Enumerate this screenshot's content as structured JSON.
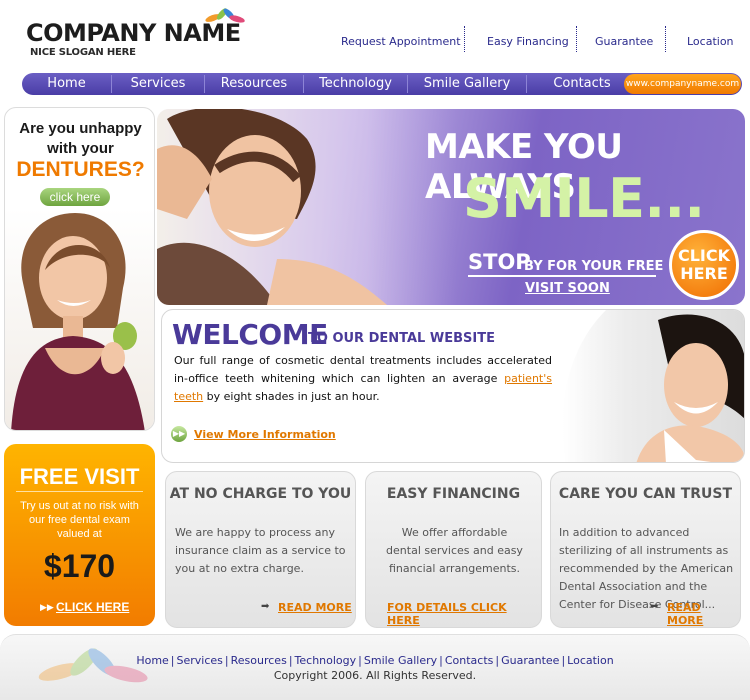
{
  "header": {
    "company_name": "COMPANY NAME",
    "slogan": "NICE SLOGAN HERE",
    "top_links": [
      "Request Appointment",
      "Easy Financing",
      "Guarantee",
      "Location"
    ]
  },
  "nav": {
    "items": [
      "Home",
      "Services",
      "Resources",
      "Technology",
      "Smile Gallery",
      "Contacts"
    ],
    "url": "www.companyname.com"
  },
  "promo": {
    "line1": "Are you unhappy",
    "line2": "with your",
    "line3": "DENTURES?",
    "button": "click here"
  },
  "free_visit": {
    "title": "FREE VISIT",
    "text": "Try us out at no risk with our free dental exam valued at",
    "price": "$170",
    "cta": "CLICK HERE"
  },
  "hero": {
    "line1": "MAKE YOU ALWAYS",
    "line2": "SMILE...",
    "stop": "STOP",
    "stop_rest": "BY FOR YOUR FREE",
    "visit": "VISIT SOON",
    "click1": "CLICK",
    "click2": "HERE"
  },
  "welcome": {
    "title": "WELCOME",
    "subtitle": "TO OUR DENTAL WEBSITE",
    "body_before": "Our full range of cosmetic dental treatments includes accelerated in-office teeth whitening which can lighten an average ",
    "body_link": "patient's teeth",
    "body_after": " by eight shades in just an hour.",
    "more": "View More Information"
  },
  "cards": [
    {
      "title": "AT NO CHARGE TO YOU",
      "body": "We are happy to process any insurance claim as a service to you at no extra charge.",
      "link": "READ MORE"
    },
    {
      "title": "EASY FINANCING",
      "body": "We offer affordable dental services and easy financial arrangements.",
      "link": "FOR DETAILS CLICK HERE"
    },
    {
      "title": "CARE YOU CAN TRUST",
      "body": "In addition to advanced sterilizing of all instruments as recommended by the American Dental Association and the Center for Disease Control...",
      "link": "READ MORE"
    }
  ],
  "footer": {
    "links": [
      "Home",
      "Services",
      "Resources",
      "Technology",
      "Smile Gallery",
      "Contacts",
      "Guarantee",
      "Location"
    ],
    "copyright": "Copyright 2006. All Rights Reserved."
  },
  "colors": {
    "nav_purple": "#5a4db5",
    "accent_orange": "#f07b00",
    "heading_purple": "#4a3a99",
    "smile_green": "#d4f2a6"
  }
}
